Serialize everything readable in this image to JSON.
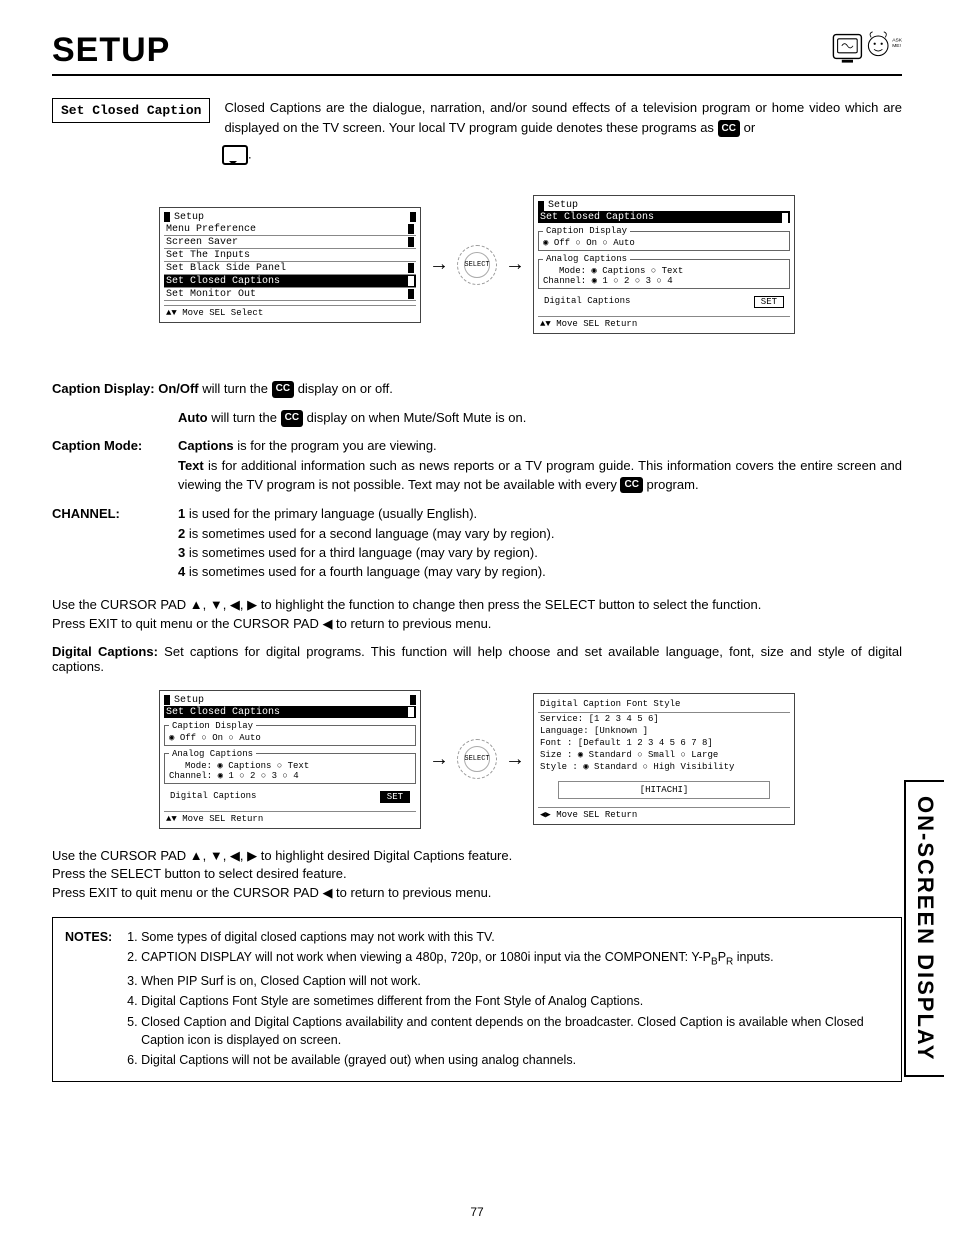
{
  "page_title": "SETUP",
  "side_tab": "ON-SCREEN DISPLAY",
  "page_number": "77",
  "box_label": "Set Closed Caption",
  "intro": {
    "line1": "Closed Captions are the dialogue, narration, and/or sound effects of a television program or home video which are displayed on the TV screen.  Your local TV program guide denotes these programs as ",
    "or": " or",
    "period": "."
  },
  "osd1": {
    "title": "Setup",
    "items": [
      "Menu Preference",
      "Screen Saver",
      "Set The Inputs",
      "Set Black Side Panel",
      "Set Closed Captions",
      "Set Monitor Out"
    ],
    "selected_index": 4,
    "footer": "▲▼ Move  SEL Select"
  },
  "osd2": {
    "title": "Setup",
    "sub": "Set Closed Captions",
    "caption_display_legend": "Caption Display",
    "caption_display": "◉ Off      ○ On           ○ Auto",
    "analog_legend": "Analog Captions",
    "analog_mode": "Mode: ◉ Captions     ○ Text",
    "analog_channel": "Channel: ◉ 1 ○ 2 ○ 3  ○ 4",
    "digital_label": "Digital Captions",
    "set_btn": "SET",
    "footer": "▲▼ Move  SEL Return"
  },
  "desc": {
    "caption_display_label": "Caption Display:",
    "onoff_b": "On/Off",
    "onoff_t": " will turn the ",
    "onoff_t2": " display on or off.",
    "auto_b": "Auto",
    "auto_t": " will turn the ",
    "auto_t2": " display on when Mute/Soft Mute is on.",
    "mode_label": "Caption Mode:",
    "captions_b": "Captions",
    "captions_t": " is for the program you are viewing.",
    "text_b": "Text",
    "text_t": " is for additional information such as news reports or a TV program guide.  This information covers the entire screen and viewing the TV program is not possible.  Text may not be available with every ",
    "text_t2": " program.",
    "channel_label": "CHANNEL:",
    "ch1_b": "1",
    "ch1_t": " is used for the primary language (usually English).",
    "ch2_b": "2",
    "ch2_t": " is sometimes used for a second language (may vary by region).",
    "ch3_b": "3",
    "ch3_t": " is sometimes used for a third language (may vary by region).",
    "ch4_b": "4",
    "ch4_t": " is sometimes used for a fourth language (may vary by region).",
    "cursor1": "Use the CURSOR PAD ▲, ▼, ◀, ▶ to highlight the function to change then press the SELECT button to select the function.",
    "cursor2": "Press EXIT to quit menu or the CURSOR PAD ◀ to return to previous menu.",
    "digital_b": "Digital Captions:",
    "digital_t": " Set captions for digital programs.  This function will help choose and set  available language, font, size and style of digital captions."
  },
  "osd3": {
    "title": "Setup",
    "sub": "Set Closed Captions",
    "caption_display_legend": "Caption Display",
    "caption_display": "◉ Off     ○ On         ○ Auto",
    "analog_legend": "Analog Captions",
    "analog_mode": "Mode: ◉ Captions    ○ Text",
    "analog_channel": "Channel: ◉ 1 ○ 2 ○ 3  ○ 4",
    "digital_label": "Digital Captions",
    "set_btn": "SET",
    "footer": "▲▼ Move  SEL Return"
  },
  "osd4": {
    "title": "Digital Caption Font Style",
    "service": "Service:  [1 2 3 4 5 6]",
    "language": "Language: [Unknown    ]",
    "font": "Font    : [Default 1 2 3 4 5 6 7 8]",
    "size": "Size    : ◉ Standard ○ Small  ○ Large",
    "style": "Style   : ◉ Standard ○ High Visibility",
    "brand": "[HITACHI]",
    "footer": "◀▶ Move  SEL Return"
  },
  "desc2": {
    "l1": "Use the CURSOR PAD ▲, ▼, ◀, ▶ to highlight desired Digital Captions feature.",
    "l2": "Press the SELECT button to select desired feature.",
    "l3": "Press EXIT to quit menu or the CURSOR PAD ◀ to return to previous menu."
  },
  "notes": {
    "label": "NOTES:",
    "items": [
      "Some types of digital closed captions may not work with this TV.",
      "CAPTION DISPLAY will not work when viewing a 480p, 720p, or 1080i input via the COMPONENT: Y-PBPR inputs.",
      "When PIP Surf is on, Closed Caption will not work.",
      "Digital Captions Font Style are sometimes different from the Font Style of Analog Captions.",
      "Closed Caption and Digital Captions availability and content depends on the broadcaster.  Closed Caption is available when Closed Caption icon is displayed on screen.",
      "Digital Captions will not be available (grayed out) when using analog channels."
    ]
  }
}
